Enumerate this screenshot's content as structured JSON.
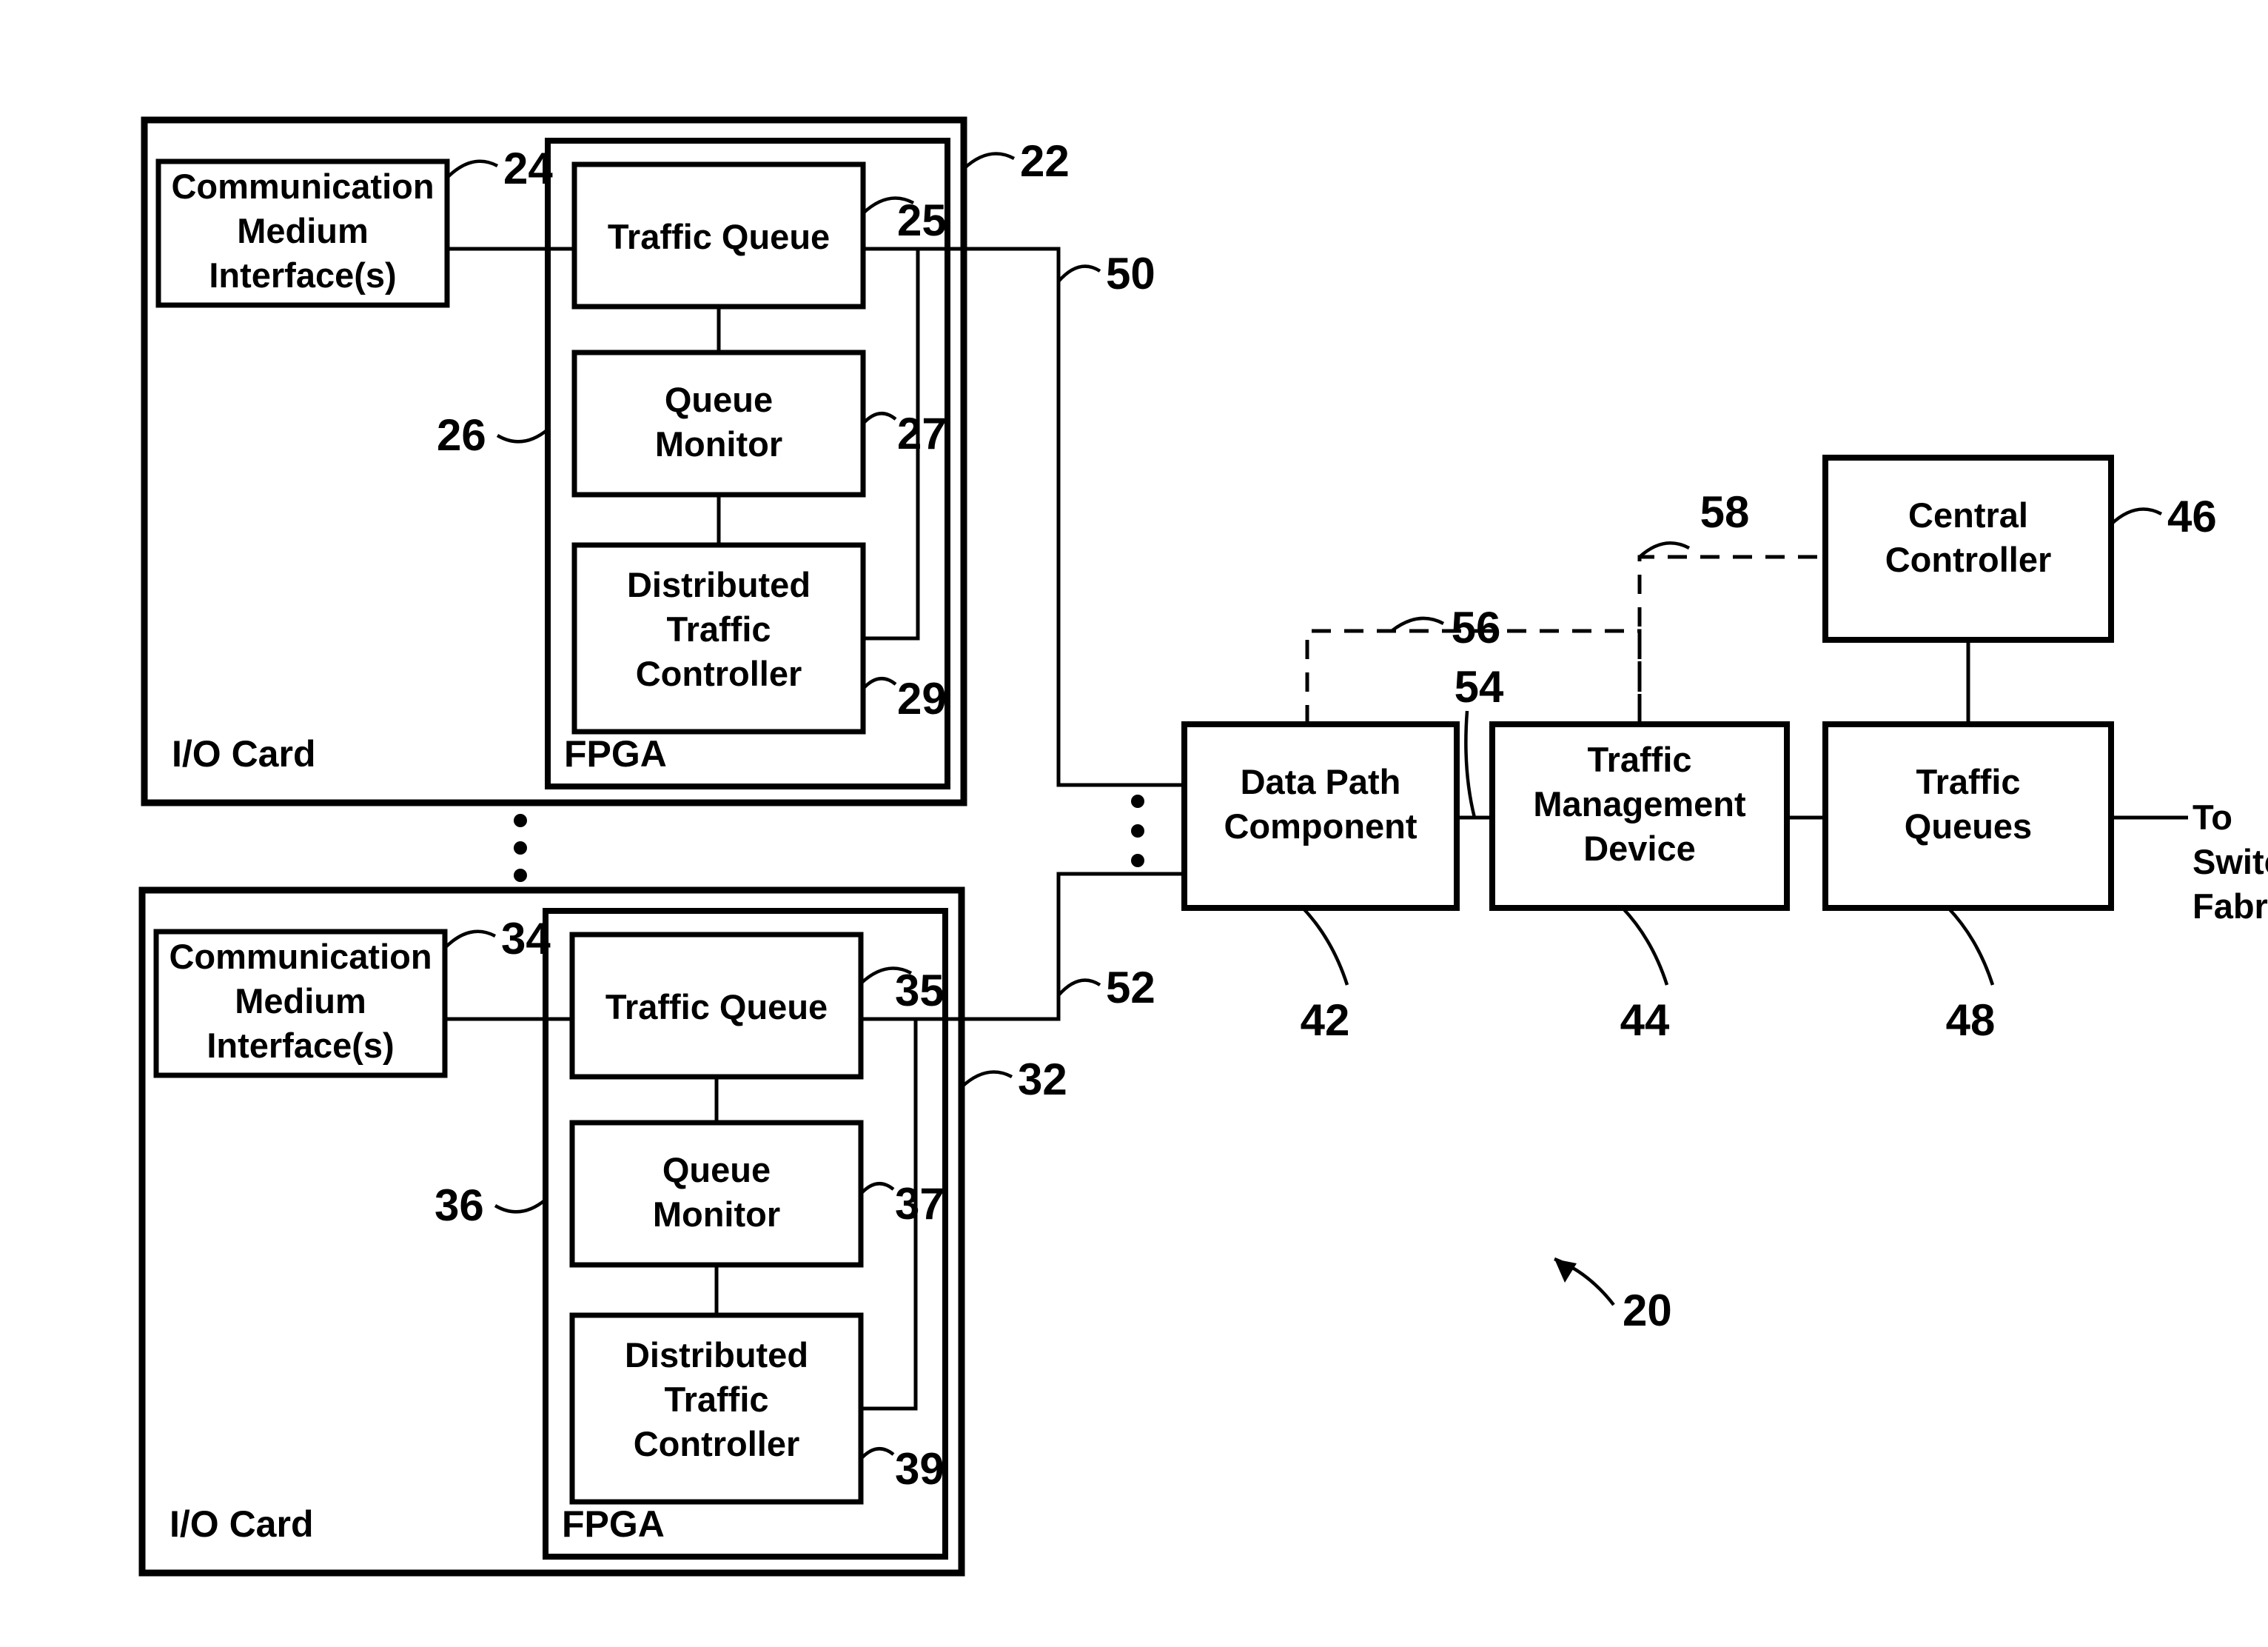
{
  "figure": {
    "title_ref": "20",
    "io_cards": [
      {
        "card_label": "I/O Card",
        "card_ref": "22",
        "fpga_label": "FPGA",
        "fpga_ref": "26",
        "interface_label": "Communication Medium Interface(s)",
        "interface_lines": [
          "Communication",
          "Medium",
          "Interface(s)"
        ],
        "interface_ref": "24",
        "queue_label": "Traffic Queue",
        "queue_ref": "25",
        "monitor_lines": [
          "Queue",
          "Monitor"
        ],
        "monitor_ref": "27",
        "controller_lines": [
          "Distributed",
          "Traffic",
          "Controller"
        ],
        "controller_ref": "29",
        "link_ref": "50"
      },
      {
        "card_label": "I/O Card",
        "card_ref": "32",
        "fpga_label": "FPGA",
        "fpga_ref": "36",
        "interface_label": "Communication Medium Interface(s)",
        "interface_lines": [
          "Communication",
          "Medium",
          "Interface(s)"
        ],
        "interface_ref": "34",
        "queue_label": "Traffic Queue",
        "queue_ref": "35",
        "monitor_lines": [
          "Queue",
          "Monitor"
        ],
        "monitor_ref": "37",
        "controller_lines": [
          "Distributed",
          "Traffic",
          "Controller"
        ],
        "controller_ref": "39",
        "link_ref": "52"
      }
    ],
    "line_card": {
      "data_path": {
        "lines": [
          "Data Path",
          "Component"
        ],
        "ref": "42"
      },
      "traffic_mgmt": {
        "lines": [
          "Traffic",
          "Management",
          "Device"
        ],
        "ref": "44"
      },
      "central_controller": {
        "lines": [
          "Central",
          "Controller"
        ],
        "ref": "46"
      },
      "traffic_queues": {
        "lines": [
          "Traffic",
          "Queues"
        ],
        "ref": "48"
      },
      "dpc_tmd_link_ref": "54",
      "dpc_control_ref": "56",
      "tmd_control_ref": "58",
      "egress_label_lines": [
        "To",
        "Switch",
        "Fabric"
      ]
    },
    "ellipsis_between_cards": "⋮",
    "ellipsis_on_bus": "⋮"
  },
  "colors": {
    "ink": "#000000",
    "paper": "#ffffff"
  }
}
